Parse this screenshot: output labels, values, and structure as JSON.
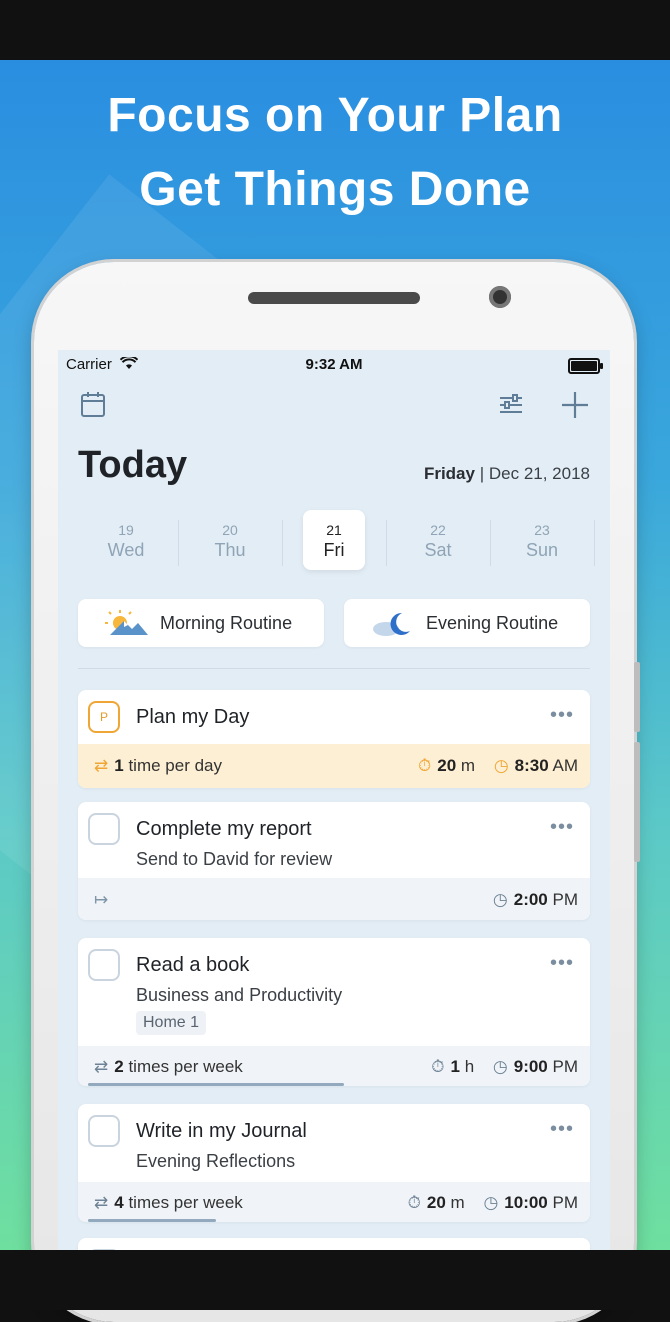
{
  "promo": {
    "headline_1": "Focus on Your Plan",
    "headline_2": "Get Things Done"
  },
  "status_bar": {
    "carrier": "Carrier",
    "time": "9:32 AM"
  },
  "header": {
    "title": "Today",
    "weekday": "Friday",
    "date": "| Dec 21, 2018"
  },
  "days": [
    {
      "num": "19",
      "name": "Wed"
    },
    {
      "num": "20",
      "name": "Thu"
    },
    {
      "num": "21",
      "name": "Fri",
      "selected": true
    },
    {
      "num": "22",
      "name": "Sat"
    },
    {
      "num": "23",
      "name": "Sun"
    }
  ],
  "routines": {
    "morning": "Morning Routine",
    "evening": "Evening Routine"
  },
  "tasks": [
    {
      "badge": "P",
      "title": "Plan my Day",
      "repeat_count": "1",
      "repeat_text": "time per day",
      "duration_value": "20",
      "duration_unit": "m",
      "time": "8:30",
      "ampm": "AM"
    },
    {
      "title": "Complete my report",
      "subtitle": "Send to David for review",
      "time": "2:00",
      "ampm": "PM"
    },
    {
      "title": "Read a book",
      "subtitle": "Business and Productivity",
      "tag": "Home 1",
      "repeat_count": "2",
      "repeat_text": "times per week",
      "duration_value": "1",
      "duration_unit": "h",
      "time": "9:00",
      "ampm": "PM",
      "progress": 0.5
    },
    {
      "title": "Write in my Journal",
      "subtitle": "Evening Reflections",
      "repeat_count": "4",
      "repeat_text": "times per week",
      "duration_value": "20",
      "duration_unit": "m",
      "time": "10:00",
      "ampm": "PM",
      "progress": 0.25
    }
  ],
  "icons": {
    "calendar": "calendar-icon",
    "filter": "sliders-icon",
    "add": "plus-icon",
    "more": "more-dots-icon",
    "repeat": "repeat-icon",
    "timer": "stopwatch-icon",
    "clock": "clock-icon",
    "arrow": "arrow-right-bar-icon"
  },
  "colors": {
    "accent_orange": "#f0a634",
    "highlight_row": "#fdefd3",
    "screen_bg": "#e3edf5"
  }
}
